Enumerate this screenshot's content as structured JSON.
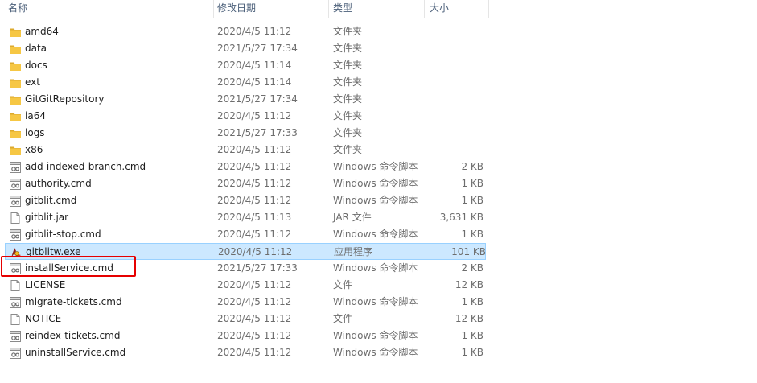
{
  "columns": {
    "name": "名称",
    "date": "修改日期",
    "type": "类型",
    "size": "大小"
  },
  "colors": {
    "folder": "#f6c744",
    "selected_bg": "#cce8ff",
    "highlight": "#e60000"
  },
  "files": [
    {
      "name": "amd64",
      "date": "2020/4/5 11:12",
      "type": "文件夹",
      "size": "",
      "icon": "folder-icon"
    },
    {
      "name": "data",
      "date": "2021/5/27 17:34",
      "type": "文件夹",
      "size": "",
      "icon": "folder-icon"
    },
    {
      "name": "docs",
      "date": "2020/4/5 11:14",
      "type": "文件夹",
      "size": "",
      "icon": "folder-icon"
    },
    {
      "name": "ext",
      "date": "2020/4/5 11:14",
      "type": "文件夹",
      "size": "",
      "icon": "folder-icon"
    },
    {
      "name": "GitGitRepository",
      "date": "2021/5/27 17:34",
      "type": "文件夹",
      "size": "",
      "icon": "folder-icon"
    },
    {
      "name": "ia64",
      "date": "2020/4/5 11:12",
      "type": "文件夹",
      "size": "",
      "icon": "folder-icon"
    },
    {
      "name": "logs",
      "date": "2021/5/27 17:33",
      "type": "文件夹",
      "size": "",
      "icon": "folder-icon"
    },
    {
      "name": "x86",
      "date": "2020/4/5 11:12",
      "type": "文件夹",
      "size": "",
      "icon": "folder-icon"
    },
    {
      "name": "add-indexed-branch.cmd",
      "date": "2020/4/5 11:12",
      "type": "Windows 命令脚本",
      "size": "2 KB",
      "icon": "cmd-script-icon"
    },
    {
      "name": "authority.cmd",
      "date": "2020/4/5 11:12",
      "type": "Windows 命令脚本",
      "size": "1 KB",
      "icon": "cmd-script-icon"
    },
    {
      "name": "gitblit.cmd",
      "date": "2020/4/5 11:12",
      "type": "Windows 命令脚本",
      "size": "1 KB",
      "icon": "cmd-script-icon"
    },
    {
      "name": "gitblit.jar",
      "date": "2020/4/5 11:13",
      "type": "JAR 文件",
      "size": "3,631 KB",
      "icon": "file-icon"
    },
    {
      "name": "gitblit-stop.cmd",
      "date": "2020/4/5 11:12",
      "type": "Windows 命令脚本",
      "size": "1 KB",
      "icon": "cmd-script-icon"
    },
    {
      "name": "gitblitw.exe",
      "date": "2020/4/5 11:12",
      "type": "应用程序",
      "size": "101 KB",
      "icon": "exe-app-icon",
      "selected": true
    },
    {
      "name": "installService.cmd",
      "date": "2021/5/27 17:33",
      "type": "Windows 命令脚本",
      "size": "2 KB",
      "icon": "cmd-script-icon",
      "highlighted": true
    },
    {
      "name": "LICENSE",
      "date": "2020/4/5 11:12",
      "type": "文件",
      "size": "12 KB",
      "icon": "file-icon"
    },
    {
      "name": "migrate-tickets.cmd",
      "date": "2020/4/5 11:12",
      "type": "Windows 命令脚本",
      "size": "1 KB",
      "icon": "cmd-script-icon"
    },
    {
      "name": "NOTICE",
      "date": "2020/4/5 11:12",
      "type": "文件",
      "size": "12 KB",
      "icon": "file-icon"
    },
    {
      "name": "reindex-tickets.cmd",
      "date": "2020/4/5 11:12",
      "type": "Windows 命令脚本",
      "size": "1 KB",
      "icon": "cmd-script-icon"
    },
    {
      "name": "uninstallService.cmd",
      "date": "2020/4/5 11:12",
      "type": "Windows 命令脚本",
      "size": "1 KB",
      "icon": "cmd-script-icon"
    }
  ]
}
